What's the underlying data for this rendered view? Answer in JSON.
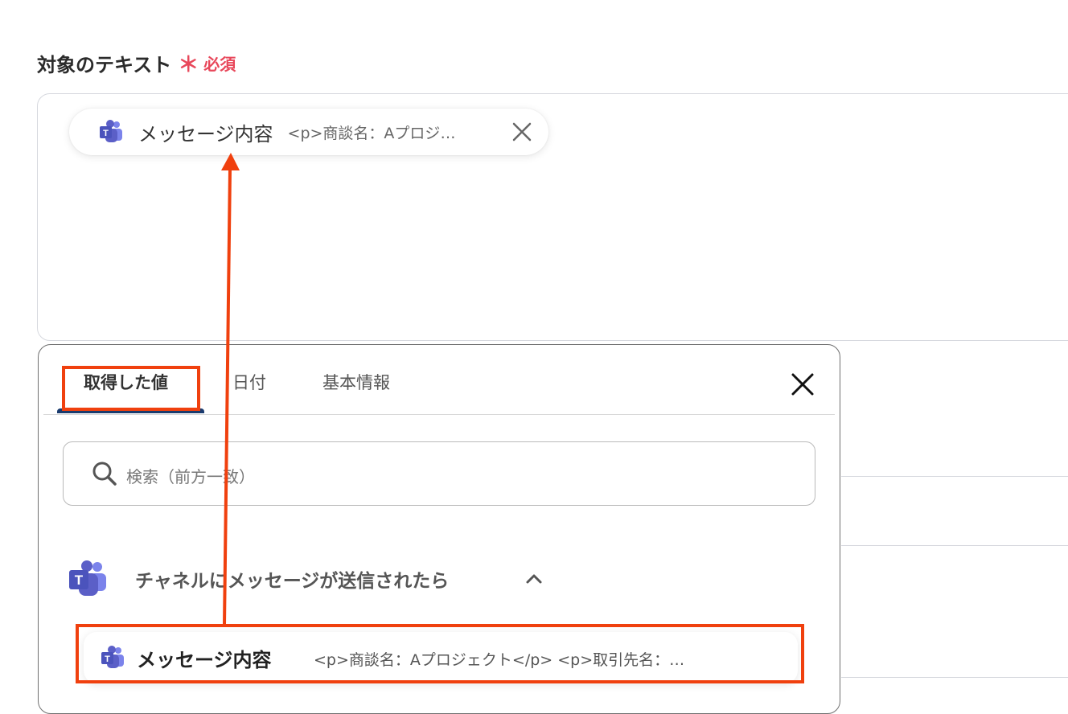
{
  "field": {
    "label": "対象のテキスト",
    "required_mark": "＊",
    "required_text": "必須"
  },
  "chip": {
    "icon": "teams-icon",
    "title": "メッセージ内容",
    "value": "<p>商談名：Aプロジェクト</p>",
    "close_icon": "close-icon"
  },
  "popup": {
    "tabs": [
      {
        "label": "取得した値",
        "active": true
      },
      {
        "label": "日付",
        "active": false
      },
      {
        "label": "基本情報",
        "active": false
      }
    ],
    "close_icon": "close-icon",
    "search": {
      "icon": "search-icon",
      "placeholder": "検索（前方一致）"
    },
    "group": {
      "icon": "teams-icon",
      "label": "チャネルにメッセージが送信されたら",
      "chevron": "chevron-up-icon"
    },
    "item": {
      "icon": "teams-icon",
      "title": "メッセージ内容",
      "value": "<p>商談名：Aプロジェクト</p> <p>取引先名：…"
    }
  },
  "colors": {
    "required": "#e8475a",
    "highlight": "#f0400e",
    "tab_underline": "#1a3b6e",
    "teams_purple": "#5b5fc7"
  }
}
